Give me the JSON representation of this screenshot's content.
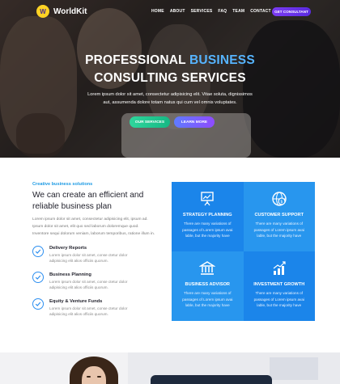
{
  "brand": {
    "name": "WorldKit",
    "logo_letter": "W"
  },
  "nav": {
    "items": [
      "HOME",
      "ABOUT",
      "SERVICES",
      "FAQ",
      "TEAM",
      "CONTACT"
    ],
    "cta": "GET CONSULTANT"
  },
  "hero": {
    "title_line1_a": "PROFESSIONAL ",
    "title_line1_b": "BUSINESS",
    "title_line2": "CONSULTING SERVICES",
    "desc_line1": "Lorem ipsum dolor sit amet, consectetur adipisicing elit. Vitae soluta, dignissimos",
    "desc_line2": "aut, assumenda dolore totam natus qui cum vel omnis voluptates.",
    "btn_services": "OUR SERVICES",
    "btn_more": "LEARN MORE"
  },
  "features": {
    "kicker": "Creative business solutions",
    "title_line1": "We can create an efficient and",
    "title_line2": "reliable business plan",
    "para": [
      "Lorem ipsum dolor sit amet, consectetur adipisicing elit, ipsum ad.",
      "Ipsum dolor sit amet, elit quo sed laborum doloremque quod.",
      "Inventore sequi dolorum veniam, laborum temporibus, ratione illum in."
    ],
    "items": [
      {
        "title": "Delivery Reports",
        "line1": "Lorem ipsum dolor sit amet, conse ctetur dolor",
        "line2": "adipisicing elit alios officiis quorum."
      },
      {
        "title": "Business Planning",
        "line1": "Lorem ipsum dolor sit amet, conse ctetur dolor",
        "line2": "adipisicing elit alios officiis quorum."
      },
      {
        "title": "Equity & Venture Funds",
        "line1": "Lorem ipsum dolor sit amet, conse ctetur dolor",
        "line2": "adipisicing elit alios officiis quorum."
      }
    ]
  },
  "services": [
    {
      "icon": "presentation-board-icon",
      "title": "STRATEGY PLANNING",
      "line1": "There are many variations of",
      "line2": "passages of Lorem ipsum avai",
      "line3": "lable, but the majority have"
    },
    {
      "icon": "globe-dollar-icon",
      "title": "CUSTOMER SUPPORT",
      "line1": "There are many variations of",
      "line2": "passages of Lorem ipsum avai",
      "line3": "lable, but the majority have"
    },
    {
      "icon": "bank-building-icon",
      "title": "BUSINESS ADVISOR",
      "line1": "There are many variations of",
      "line2": "passages of Lorem ipsum avai",
      "line3": "lable, but the majority have"
    },
    {
      "icon": "growth-chart-icon",
      "title": "INVESTMENT GROWTH",
      "line1": "There are many variations of",
      "line2": "passages of Lorem ipsum avai",
      "line3": "lable, but the majority have"
    }
  ],
  "colors": {
    "primary_blue": "#1b85ea",
    "accent_cyan": "#56b4ff",
    "cta_purple": "#6a34ea",
    "green_button": "#1fc98f"
  }
}
